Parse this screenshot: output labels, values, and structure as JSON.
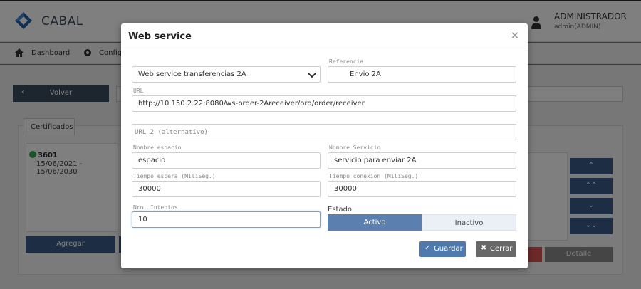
{
  "app": {
    "brand": "CABAL",
    "user_name": "ADMINISTRADOR",
    "user_sub": "admin(ADMIN)"
  },
  "nav": {
    "dashboard": "Dashboard",
    "config": "Config"
  },
  "background": {
    "volver": "Volver",
    "tab_certificados": "Certificados",
    "cert_id": "3601",
    "cert_dates": "15/06/2021 - 15/06/2030",
    "agregar": "Agregar",
    "detalle": "Detalle",
    "side_buttons": [
      "⌃",
      "⌃⌃",
      "⌄",
      "⌄⌄"
    ]
  },
  "modal": {
    "title": "Web service",
    "close": "×",
    "service_select": "Web service transferencias 2A",
    "referencia_label": "Referencia",
    "referencia_value": "Envio 2A",
    "url_label": "URL",
    "url_value": "http://10.150.2.22:8080/ws-order-2Areceiver/ord/order/receiver",
    "url2_placeholder": "URL 2 (alternativo)",
    "nombre_espacio_label": "Nombre espacio",
    "nombre_espacio_value": "espacio",
    "nombre_servicio_label": "Nombre Servicio",
    "nombre_servicio_value": "servicio para enviar 2A",
    "tiempo_espera_label": "Tiempo espera (MiliSeg.)",
    "tiempo_espera_value": "30000",
    "tiempo_conexion_label": "Tiempo conexion (MiliSeg.)",
    "tiempo_conexion_value": "30000",
    "intentos_label": "Nro. Intentos",
    "intentos_value": "10",
    "estado_label": "Estado",
    "estado_activo": "Activo",
    "estado_inactivo": "Inactivo",
    "guardar": "Guardar",
    "cerrar": "Cerrar"
  },
  "colors": {
    "primary": "#3b5b86",
    "toggle_active": "#5b7fae",
    "guardar": "#4f7aad",
    "cerrar": "#686868",
    "success": "#2fa84f"
  }
}
